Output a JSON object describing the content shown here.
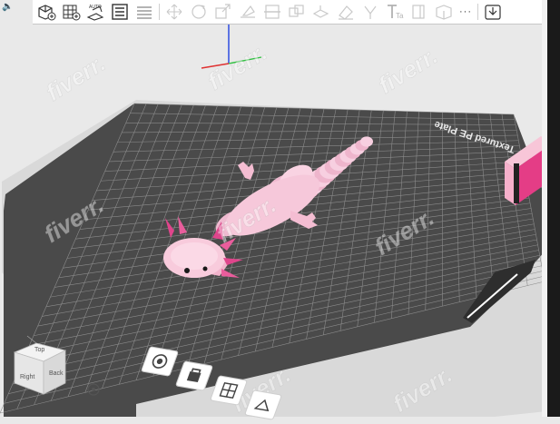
{
  "toolbar": {
    "auto_label": "AUTO",
    "text_tool_label": "Ta",
    "more_label": "···"
  },
  "bed": {
    "plate_label": "Textured PE Plate"
  },
  "view_cube": {
    "top_label": "Top",
    "right_label": "Right",
    "back_label": "Back"
  },
  "watermark": {
    "text": "fiverr."
  },
  "colors": {
    "bed_fill": "#4a4a4a",
    "grid_line": "#8a8a8a",
    "model_pink": "#f4c3d6",
    "model_accent": "#e0458c",
    "background": "#e9e9e9",
    "axis_x": "#e03030",
    "axis_y": "#30c040",
    "axis_z": "#2040e0"
  },
  "icons": [
    "add-cube-icon",
    "arrange-grid-icon",
    "auto-orient-icon",
    "layout-icon",
    "slice-layers-icon",
    "move-icon",
    "rotate-icon",
    "scale-icon",
    "lay-on-face-icon",
    "cut-icon",
    "split-objects-icon",
    "split-parts-icon",
    "support-paint-icon",
    "seam-paint-icon",
    "text-icon",
    "measure-icon",
    "assembly-icon",
    "more-icon",
    "slice-plate-icon"
  ]
}
